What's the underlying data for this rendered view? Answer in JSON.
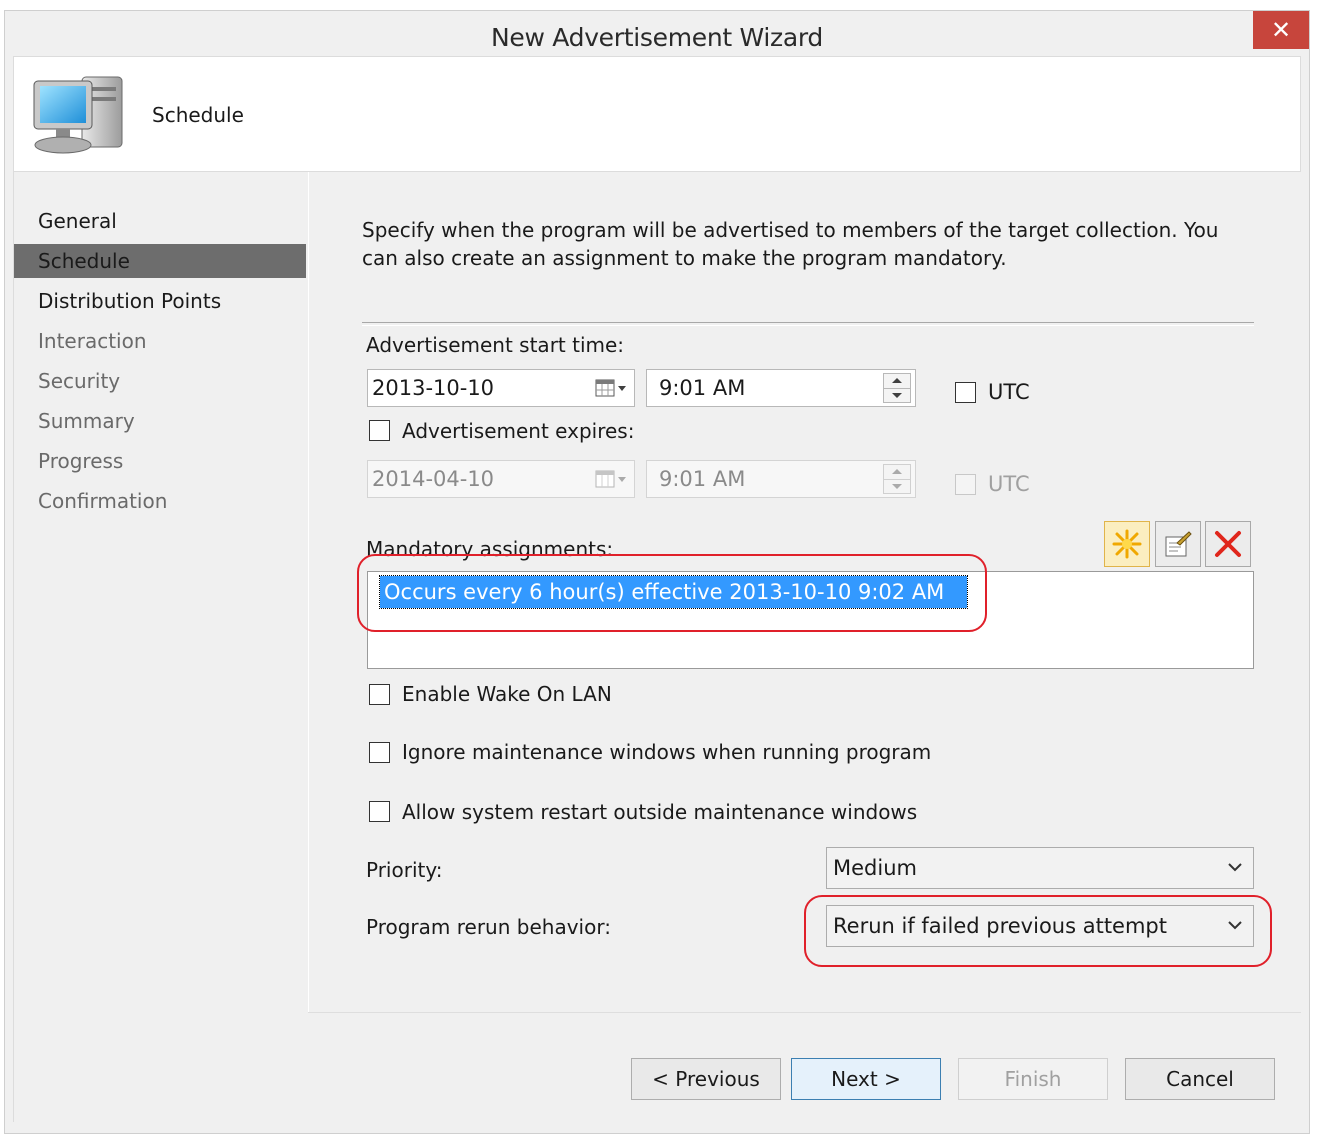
{
  "window": {
    "title": "New Advertisement Wizard",
    "close_glyph": "✕"
  },
  "header": {
    "title": "Schedule",
    "icon": "computer-icon"
  },
  "nav": {
    "items": [
      {
        "label": "General",
        "state": "done"
      },
      {
        "label": "Schedule",
        "state": "active"
      },
      {
        "label": "Distribution Points",
        "state": "done"
      },
      {
        "label": "Interaction",
        "state": "pending"
      },
      {
        "label": "Security",
        "state": "pending"
      },
      {
        "label": "Summary",
        "state": "pending"
      },
      {
        "label": "Progress",
        "state": "pending"
      },
      {
        "label": "Confirmation",
        "state": "pending"
      }
    ]
  },
  "content": {
    "description": "Specify when the program will be advertised to members of the target collection. You can also create an assignment to make the program mandatory.",
    "start_time": {
      "label": "Advertisement start time:",
      "date": "2013-10-10",
      "time": "9:01 AM",
      "utc_label": "UTC",
      "utc_checked": false
    },
    "expires": {
      "label": "Advertisement expires:",
      "checked": false,
      "date": "2014-04-10",
      "time": "9:01 AM",
      "utc_label": "UTC",
      "utc_checked": false
    },
    "mandatory": {
      "label": "Mandatory assignments:",
      "items": [
        "Occurs every 6 hour(s) effective 2013-10-10 9:02 AM"
      ],
      "toolbar": {
        "new_icon": "new-star-icon",
        "properties_icon": "properties-icon",
        "delete_icon": "delete-icon"
      }
    },
    "options": {
      "wake_on_lan": {
        "label": "Enable Wake On LAN",
        "checked": false
      },
      "ignore_maintenance": {
        "label": "Ignore maintenance windows when running program",
        "checked": false
      },
      "allow_restart": {
        "label": "Allow system restart outside maintenance windows",
        "checked": false
      }
    },
    "priority": {
      "label": "Priority:",
      "value": "Medium"
    },
    "rerun": {
      "label": "Program rerun behavior:",
      "value": "Rerun if failed previous attempt"
    }
  },
  "footer": {
    "previous": "< Previous",
    "next": "Next >",
    "finish": "Finish",
    "cancel": "Cancel"
  },
  "colors": {
    "close": "#c7453c",
    "selection": "#3399ff",
    "highlight": "#e0202a",
    "active_nav": "#6d6d6d"
  }
}
